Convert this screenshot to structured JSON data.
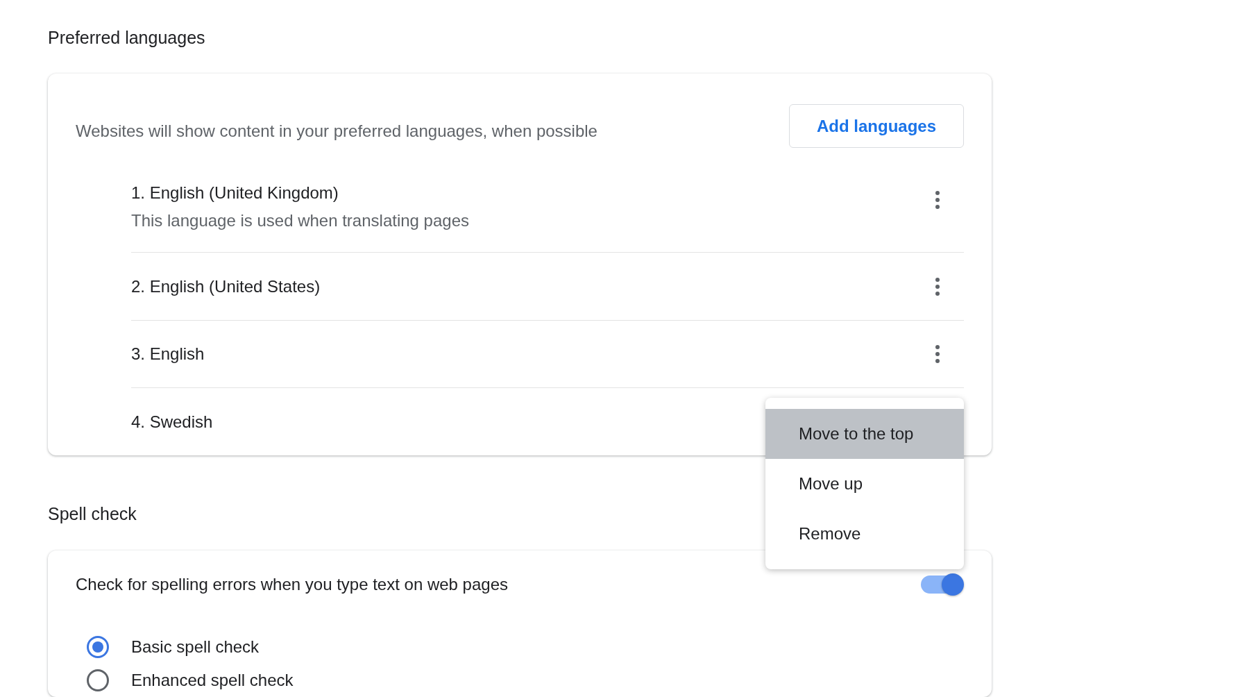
{
  "preferred_languages": {
    "title": "Preferred languages",
    "description": "Websites will show content in your preferred languages, when possible",
    "add_button": "Add languages",
    "languages": [
      {
        "name": "1. English (United Kingdom)",
        "note": "This language is used when translating pages",
        "menu_open": false
      },
      {
        "name": "2. English (United States)",
        "menu_open": false
      },
      {
        "name": "3. English",
        "menu_open": false
      },
      {
        "name": "4. Swedish",
        "menu_open": true
      }
    ],
    "menu": [
      {
        "label": "Move to the top",
        "selected": true
      },
      {
        "label": "Move up",
        "selected": false
      },
      {
        "label": "Remove",
        "selected": false
      }
    ]
  },
  "spell_check": {
    "title": "Spell check",
    "toggle": {
      "label": "Check for spelling errors when you type text on web pages",
      "on": true
    },
    "options": [
      {
        "label": "Basic spell check",
        "selected": true
      },
      {
        "label": "Enhanced spell check",
        "selected": false
      }
    ]
  }
}
